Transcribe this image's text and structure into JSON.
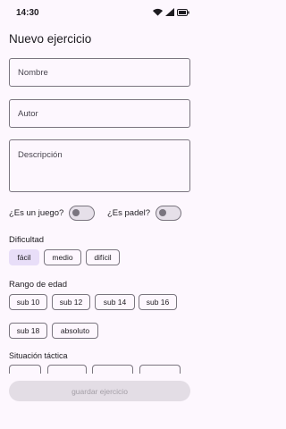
{
  "status": {
    "time": "14:30"
  },
  "page": {
    "title": "Nuevo ejercicio"
  },
  "fields": {
    "nombre": "Nombre",
    "autor": "Autor",
    "descripcion": "Descripción"
  },
  "toggles": {
    "juego": "¿Es un juego?",
    "padel": "¿Es padel?"
  },
  "dificultad": {
    "label": "Dificultad",
    "options": [
      "fácil",
      "medio",
      "difícil"
    ],
    "selected": "fácil"
  },
  "rango": {
    "label": "Rango de edad",
    "options": [
      "sub 10",
      "sub 12",
      "sub 14",
      "sub 16",
      "sub 18",
      "absoluto"
    ]
  },
  "situacion": {
    "label": "Situación táctica"
  },
  "actions": {
    "save": "guardar ejercicio"
  }
}
